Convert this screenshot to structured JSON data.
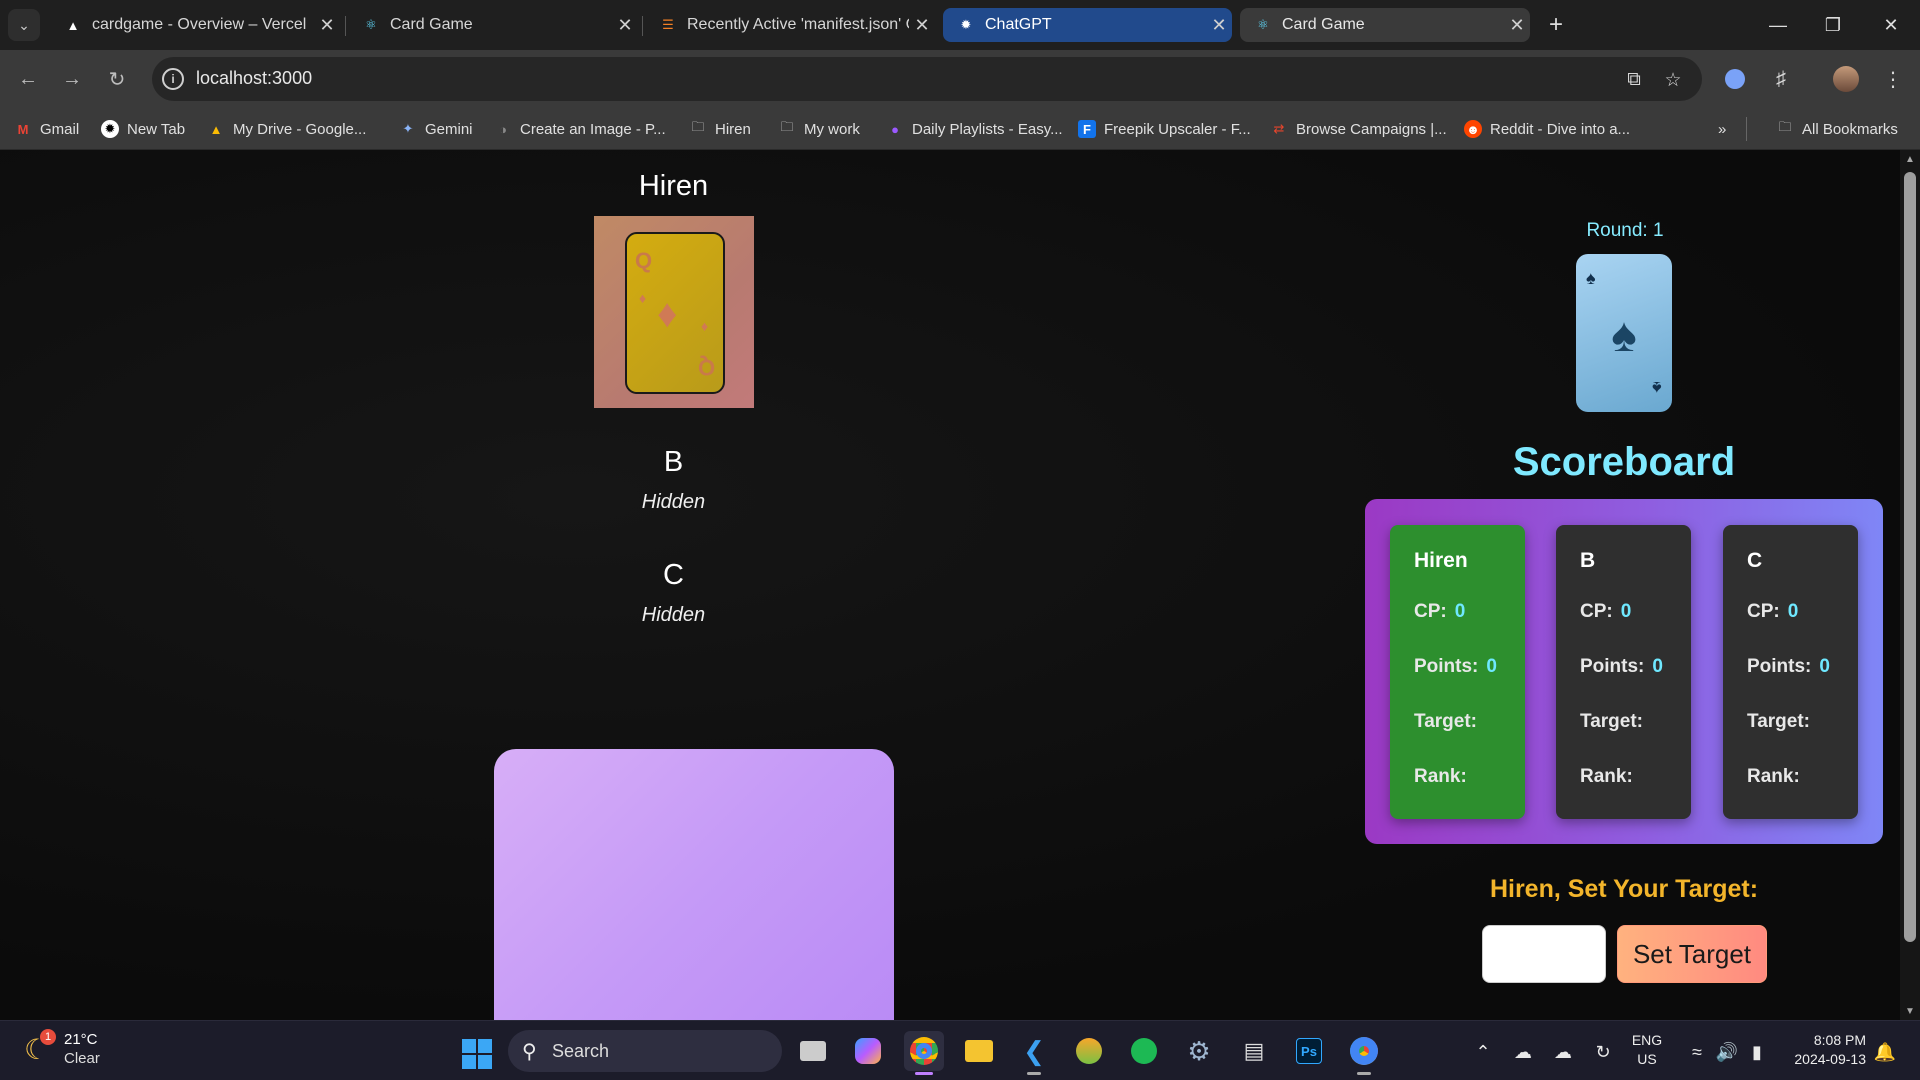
{
  "browser": {
    "tabs": [
      {
        "title": "cardgame - Overview – Vercel",
        "icon": "vercel-icon"
      },
      {
        "title": "Card Game",
        "icon": "react-icon"
      },
      {
        "title": "Recently Active 'manifest.json' C",
        "icon": "stackoverflow-icon"
      },
      {
        "title": "ChatGPT",
        "icon": "chatgpt-icon"
      },
      {
        "title": "Card Game",
        "icon": "react-icon"
      }
    ],
    "active_tab_index": 4,
    "url": "localhost:3000",
    "bookmarks": [
      {
        "label": "Gmail",
        "icon": "gmail-icon"
      },
      {
        "label": "New Tab",
        "icon": "chatgpt-icon"
      },
      {
        "label": "My Drive - Google...",
        "icon": "drive-icon"
      },
      {
        "label": "Gemini",
        "icon": "gemini-icon"
      },
      {
        "label": "Create an Image - P...",
        "icon": "globe-icon"
      },
      {
        "label": "Hiren",
        "icon": "folder-icon"
      },
      {
        "label": "My work",
        "icon": "folder-icon"
      },
      {
        "label": "Daily Playlists - Easy...",
        "icon": "playlist-icon"
      },
      {
        "label": "Freepik Upscaler - F...",
        "icon": "freepik-icon"
      },
      {
        "label": "Browse Campaigns |...",
        "icon": "campaign-icon"
      },
      {
        "label": "Reddit - Dive into a...",
        "icon": "reddit-icon"
      }
    ],
    "all_bookmarks": "All Bookmarks"
  },
  "game": {
    "players": [
      {
        "name": "Hiren",
        "card": "Q",
        "card_suit": "diamond"
      },
      {
        "name": "B",
        "status": "Hidden"
      },
      {
        "name": "C",
        "status": "Hidden"
      }
    ],
    "round_label": "Round: 1",
    "trump_suit": "spade",
    "scoreboard": {
      "title": "Scoreboard",
      "columns": [
        {
          "name": "Hiren",
          "cp_label": "CP:",
          "cp": "0",
          "points_label": "Points:",
          "points": "0",
          "target_label": "Target:",
          "rank_label": "Rank:"
        },
        {
          "name": "B",
          "cp_label": "CP:",
          "cp": "0",
          "points_label": "Points:",
          "points": "0",
          "target_label": "Target:",
          "rank_label": "Rank:"
        },
        {
          "name": "C",
          "cp_label": "CP:",
          "cp": "0",
          "points_label": "Points:",
          "points": "0",
          "target_label": "Target:",
          "rank_label": "Rank:"
        }
      ]
    },
    "target_prompt": "Hiren, Set Your Target:",
    "target_value": "",
    "set_target_label": "Set Target"
  },
  "taskbar": {
    "weather_temp": "21°C",
    "weather_cond": "Clear",
    "weather_badge": "1",
    "search_placeholder": "Search",
    "lang_top": "ENG",
    "lang_bottom": "US",
    "time": "8:08 PM",
    "date": "2024-09-13"
  },
  "colors": {
    "scoreboard_title": "#7fe9ff",
    "target_prompt": "#f3b52b",
    "player_active_col": "#2d8f2e",
    "highlight_tab": "#214a8c"
  }
}
